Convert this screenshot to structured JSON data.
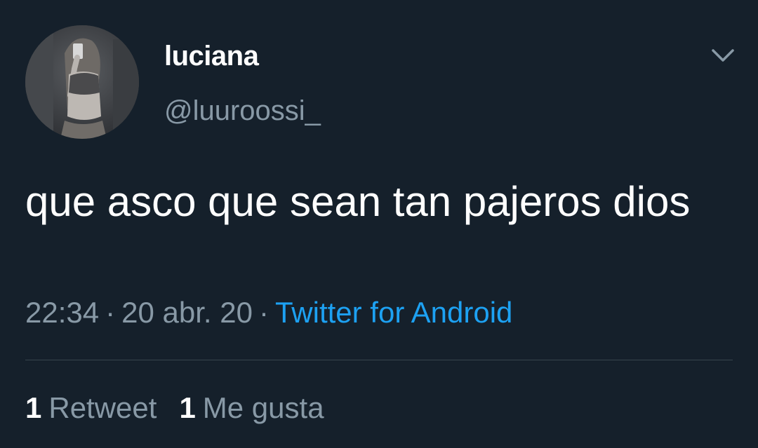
{
  "tweet": {
    "display_name": "luciana",
    "handle": "@luuroossi_",
    "text": "que asco que sean tan pajeros dios",
    "time": "22:34",
    "date": "20 abr. 20",
    "source": "Twitter for Android",
    "separator": "·",
    "stats": {
      "retweets_count": "1",
      "retweets_label": "Retweet",
      "likes_count": "1",
      "likes_label": "Me gusta"
    },
    "icons": {
      "avatar": "profile-photo",
      "caret": "chevron-down-icon"
    }
  },
  "colors": {
    "background": "#15202b",
    "primary_text": "#ffffff",
    "secondary_text": "#8899a6",
    "link": "#1da1f2",
    "divider": "#38444d"
  }
}
